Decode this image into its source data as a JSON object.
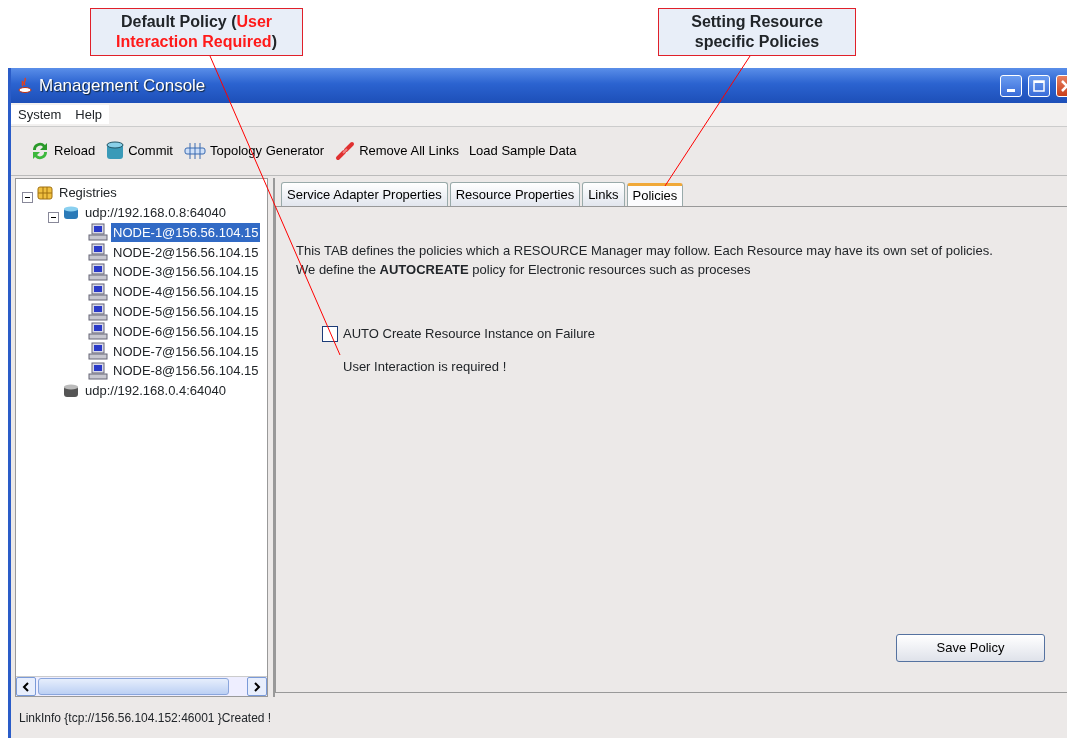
{
  "callouts": [
    {
      "segments": [
        {
          "text": "Default Policy (",
          "highlight": false
        },
        {
          "text": "User Interaction Required",
          "highlight": true
        },
        {
          "text": ")",
          "highlight": false
        }
      ]
    },
    {
      "segments": [
        {
          "text": "Setting Resource specific Policies",
          "highlight": false
        }
      ]
    }
  ],
  "window": {
    "title": "Management Console"
  },
  "menu": [
    "System",
    "Help"
  ],
  "toolbar": [
    {
      "kind": "reload",
      "label": "Reload"
    },
    {
      "kind": "commit",
      "label": "Commit"
    },
    {
      "kind": "topology",
      "label": "Topology Generator"
    },
    {
      "kind": "unlink",
      "label": "Remove All Links"
    },
    {
      "kind": "plain",
      "label": "Load Sample Data"
    }
  ],
  "tree": [
    {
      "kind": "root",
      "label": "Registries",
      "expanded": true,
      "selected": false,
      "children": [
        {
          "kind": "registry",
          "label": "udp://192.168.0.8:64040",
          "expanded": true,
          "selected": false,
          "children": [
            {
              "kind": "node",
              "label": "NODE-1@156.56.104.15",
              "selected": true
            },
            {
              "kind": "node",
              "label": "NODE-2@156.56.104.15",
              "selected": false
            },
            {
              "kind": "node",
              "label": "NODE-3@156.56.104.15",
              "selected": false
            },
            {
              "kind": "node",
              "label": "NODE-4@156.56.104.15",
              "selected": false
            },
            {
              "kind": "node",
              "label": "NODE-5@156.56.104.15",
              "selected": false
            },
            {
              "kind": "node",
              "label": "NODE-6@156.56.104.15",
              "selected": false
            },
            {
              "kind": "node",
              "label": "NODE-7@156.56.104.15",
              "selected": false
            },
            {
              "kind": "node",
              "label": "NODE-8@156.56.104.15",
              "selected": false
            }
          ]
        },
        {
          "kind": "registry-offline",
          "label": "udp://192.168.0.4:64040",
          "selected": false
        }
      ]
    }
  ],
  "tabs": [
    {
      "label": "Service Adapter Properties",
      "selected": false
    },
    {
      "label": "Resource Properties",
      "selected": false
    },
    {
      "label": "Links",
      "selected": false
    },
    {
      "label": "Policies",
      "selected": true
    }
  ],
  "policies": {
    "description": [
      "This TAB defines the policies which a RESOURCE Manager may follow. Each Resource may have its own set of policies.",
      "We define the **AUTOCREATE** policy for Electronic resources such as proceses"
    ],
    "checkbox": {
      "label": "AUTO Create Resource Instance on Failure",
      "checked": false
    },
    "note": "User Interaction is required !",
    "button": "Save Policy"
  },
  "status_bar": "LinkInfo {tcp://156.56.104.152:46001 }Created !"
}
